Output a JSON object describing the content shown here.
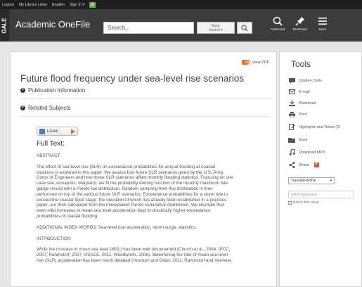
{
  "topbar": {
    "links": [
      "Logout",
      "My Library Links",
      "English",
      "Sign In ▾"
    ],
    "accessibility_icon": "accessibility-icon"
  },
  "header": {
    "brand": "GALE",
    "app_name": "Academic OneFile",
    "search_placeholder": "Search...",
    "search_type_line1": "Basic",
    "search_type_line2": "Search ▾",
    "buttons": [
      {
        "label": "Advanced",
        "icon": "advanced-search-icon"
      },
      {
        "label": "Bookmark",
        "icon": "bookmark-pin-icon"
      },
      {
        "label": "More",
        "icon": "menu-icon"
      }
    ]
  },
  "article": {
    "view_pdf": "View PDF",
    "title": "Future flood frequency under sea-level rise scenarios",
    "publication_info": "Publication Information",
    "related_subjects": "Related Subjects",
    "listen": "Listen",
    "full_text_label": "Full Text:",
    "abstract_heading": "ABSTRACT",
    "abstract_lines": [
      "The effect of sea-level rise (SLR) on exceedance probabilities for annual flooding at coastal",
      "locations is explored in this paper. We assess four future SLR scenarios given by the U.S. Army",
      "Corps of Engineers and how these SLR scenarios affect monthly flooding statistics. Focusing on one",
      "case site, Annapolis, Maryland, we fit the probability density function of the monthly maximum tide",
      "gauge record with a Pareto-tail distribution. Random sampling from this distribution is then",
      "performed on top of the various future SLR scenarios. Exceedance probabilities for a storm tide to",
      "exceed the coastal flood stage, the elevation of which has already been established in a previous",
      "paper, are then calculated from the interpolated Pareto cumulative distribution. We illustrate that",
      "even mild increases in mean sea level acceleration lead to drastically higher exceedance",
      "probabilities of coastal flooding."
    ],
    "index_words": "ADDITIONAL INDEX WORDS: Sea-level rise acceleration, storm surge, statistics.",
    "intro_heading": "INTRODUCTION",
    "intro_lines": [
      "While the increase in mean sea level (MSL) has been well documented (Church et al., 2004; IPCC,",
      "2007; Rahmstorf, 2007; USACE, 2011; Woodworth, 2006), determining the rate of mean sea-level",
      "rise (SLR) acceleration has been much debated (Houston and Dean, 2011; Rahmstorf and Vermeer,"
    ]
  },
  "tools": {
    "heading": "Tools",
    "items": [
      {
        "label": "Citation Tools",
        "icon": "citation-icon"
      },
      {
        "label": "E-mail",
        "icon": "email-icon"
      },
      {
        "label": "Download",
        "icon": "download-icon"
      },
      {
        "label": "Print",
        "icon": "print-icon"
      },
      {
        "label": "Highlights and Notes (0)",
        "icon": "highlight-icon"
      },
      {
        "label": "Save",
        "icon": "folder-icon"
      },
      {
        "label": "Download MP3",
        "icon": "music-icon"
      },
      {
        "label": "Share",
        "icon": "share-icon"
      }
    ],
    "translate_label": "Translate Article",
    "within_placeholder": "within publication",
    "limit_label": "limit to this issue"
  },
  "colors": {
    "topbar": "#1e1e1e",
    "header": "#3c3c3c",
    "accent_orange": "#e8702a",
    "accent_green": "#6cb33f"
  }
}
